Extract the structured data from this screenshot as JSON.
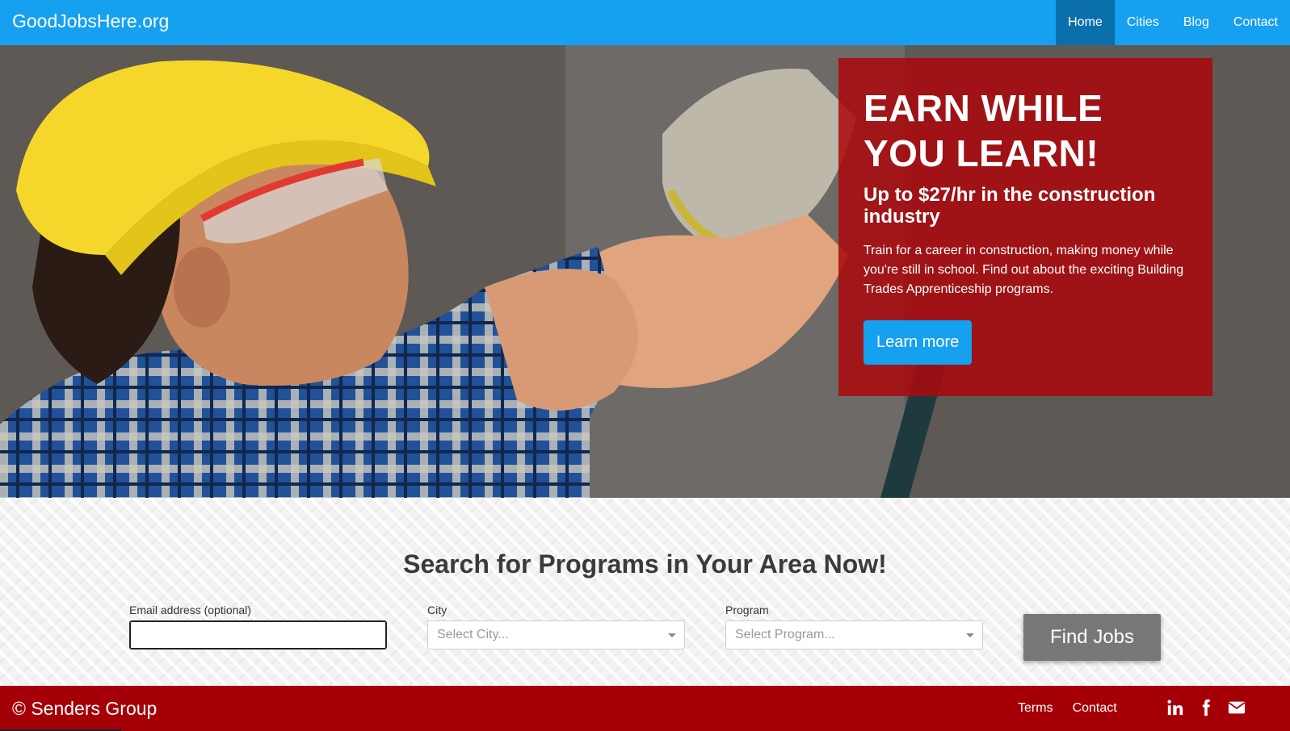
{
  "navbar": {
    "brand": "GoodJobsHere.org",
    "items": [
      {
        "label": "Home",
        "active": true
      },
      {
        "label": "Cities",
        "active": false
      },
      {
        "label": "Blog",
        "active": false
      },
      {
        "label": "Contact",
        "active": false
      }
    ]
  },
  "hero": {
    "headline": "EARN WHILE YOU LEARN!",
    "subheadline": "Up to $27/hr in the construction industry",
    "body": "Train for a career in construction, making money while you're still in school. Find out about the exciting Building Trades Apprenticeship programs.",
    "cta_label": "Learn more"
  },
  "search": {
    "title": "Search for Programs in Your Area Now!",
    "email_label": "Email address (optional)",
    "email_value": "",
    "city_label": "City",
    "city_placeholder": "Select City...",
    "program_label": "Program",
    "program_placeholder": "Select Program...",
    "submit_label": "Find Jobs"
  },
  "footer": {
    "copyright": "© Senders Group",
    "links": [
      "Terms",
      "Contact"
    ],
    "social_icons": [
      "linkedin-icon",
      "facebook-icon",
      "envelope-icon"
    ]
  },
  "colors": {
    "primary_blue": "#16a0f0",
    "nav_active": "#0a6fab",
    "callout_red": "#aa080c",
    "footer_red": "#a50008",
    "button_gray": "#777777"
  }
}
